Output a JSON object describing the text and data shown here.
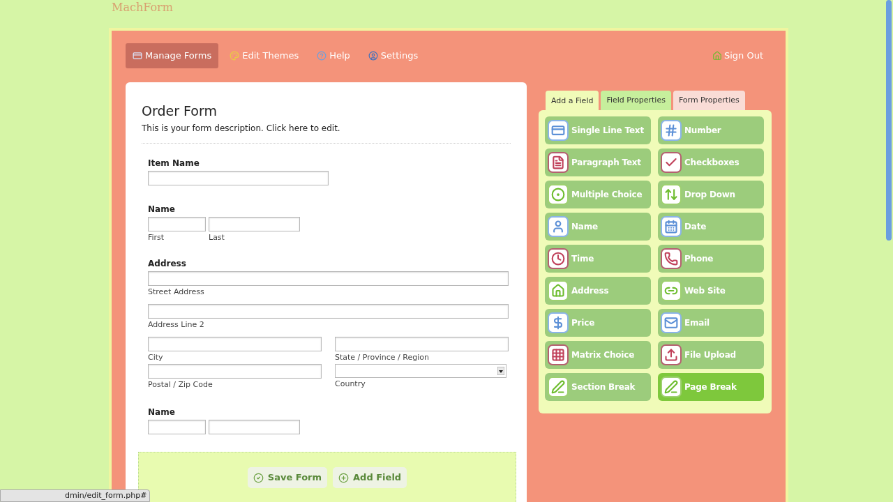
{
  "logo": "MachForm",
  "nav": [
    {
      "label": "Manage Forms",
      "kind": "forms",
      "selected": true
    },
    {
      "label": "Edit Themes",
      "kind": "themes",
      "selected": false
    },
    {
      "label": "Help",
      "kind": "help",
      "selected": false
    },
    {
      "label": "Settings",
      "kind": "settings",
      "selected": false
    }
  ],
  "sign_out": "Sign Out",
  "form": {
    "title": "Order Form",
    "description": "This is your form description. Click here to edit.",
    "fields": [
      {
        "kind": "text",
        "label": "Item Name"
      },
      {
        "kind": "name",
        "label": "Name",
        "sublabels": [
          "First",
          "Last"
        ]
      },
      {
        "kind": "address",
        "label": "Address",
        "sublabels": [
          "Street Address",
          "Address Line 2",
          "City",
          "State / Province / Region",
          "Postal / Zip Code",
          "Country"
        ]
      },
      {
        "kind": "name",
        "label": "Name"
      }
    ]
  },
  "actions": [
    {
      "label": "Save Form",
      "kind": "save"
    },
    {
      "label": "Add Field",
      "kind": "add"
    }
  ],
  "tabs": [
    {
      "label": "Add a Field",
      "selected": true,
      "color": "#f0fbb8"
    },
    {
      "label": "Field Properties",
      "selected": false,
      "color": "#c6ef9c"
    },
    {
      "label": "Form Properties",
      "selected": false,
      "color": "#f9dcd6"
    }
  ],
  "field_types": [
    {
      "label": "Single Line Text",
      "kind": "text",
      "hovered": false
    },
    {
      "label": "Number",
      "kind": "number",
      "hovered": false
    },
    {
      "label": "Paragraph Text",
      "kind": "paragraph",
      "hovered": false
    },
    {
      "label": "Checkboxes",
      "kind": "checkbox",
      "hovered": false
    },
    {
      "label": "Multiple Choice",
      "kind": "radio",
      "hovered": false
    },
    {
      "label": "Drop Down",
      "kind": "dropdown",
      "hovered": false
    },
    {
      "label": "Name",
      "kind": "name",
      "hovered": false
    },
    {
      "label": "Date",
      "kind": "date",
      "hovered": false
    },
    {
      "label": "Time",
      "kind": "time",
      "hovered": false
    },
    {
      "label": "Phone",
      "kind": "phone",
      "hovered": false
    },
    {
      "label": "Address",
      "kind": "address",
      "hovered": false
    },
    {
      "label": "Web Site",
      "kind": "link",
      "hovered": false
    },
    {
      "label": "Price",
      "kind": "price",
      "hovered": false
    },
    {
      "label": "Email",
      "kind": "email",
      "hovered": false
    },
    {
      "label": "Matrix Choice",
      "kind": "matrix",
      "hovered": false
    },
    {
      "label": "File Upload",
      "kind": "upload",
      "hovered": false
    },
    {
      "label": "Section Break",
      "kind": "section",
      "hovered": false
    },
    {
      "label": "Page Break",
      "kind": "page",
      "hovered": true
    }
  ],
  "status_url": "dmin/edit_form.php#"
}
